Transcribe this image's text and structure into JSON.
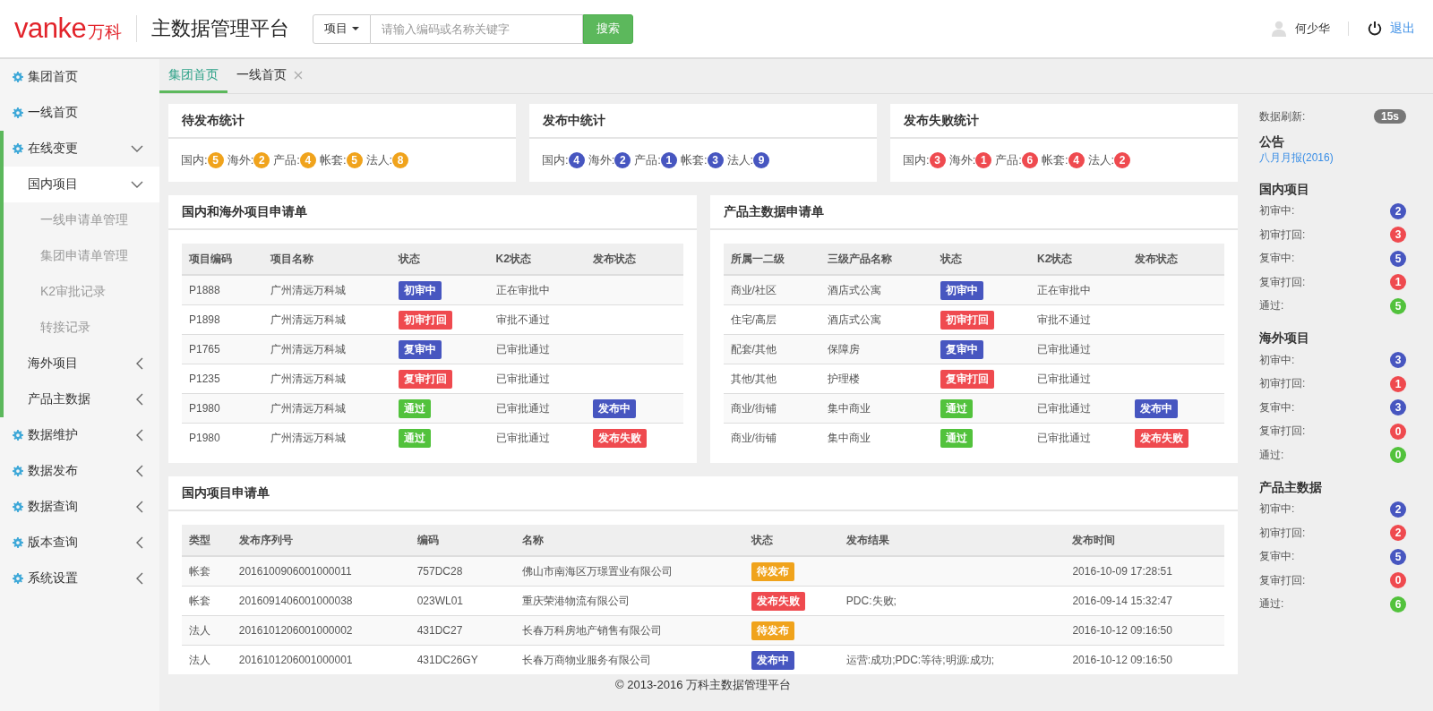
{
  "header": {
    "logo_text": "vanke",
    "logo_cn": "万科",
    "title": "主数据管理平台",
    "search": {
      "scope": "项目",
      "placeholder": "请输入编码或名称关键字",
      "button": "搜索"
    },
    "user": "何少华",
    "logout": "退出"
  },
  "sidebar": {
    "items": [
      {
        "label": "集团首页"
      },
      {
        "label": "一线首页"
      },
      {
        "label": "在线变更",
        "expanded": true,
        "children": [
          {
            "label": "国内项目",
            "expanded": true,
            "children": [
              {
                "label": "一线申请单管理"
              },
              {
                "label": "集团申请单管理"
              },
              {
                "label": "K2审批记录"
              },
              {
                "label": "转接记录"
              }
            ]
          },
          {
            "label": "海外项目",
            "expanded": false
          },
          {
            "label": "产品主数据",
            "expanded": false
          }
        ]
      },
      {
        "label": "数据维护",
        "expanded": false
      },
      {
        "label": "数据发布",
        "expanded": false
      },
      {
        "label": "数据查询",
        "expanded": false
      },
      {
        "label": "版本查询",
        "expanded": false
      },
      {
        "label": "系统设置",
        "expanded": false
      }
    ]
  },
  "tabs": [
    {
      "label": "集团首页",
      "selected": true,
      "closable": false
    },
    {
      "label": "一线首页",
      "selected": false,
      "closable": true
    }
  ],
  "stat_cards": [
    {
      "title": "待发布统计",
      "color": "#f0a31c",
      "items": [
        {
          "label": "国内:",
          "count": "5"
        },
        {
          "label": "海外:",
          "count": "2"
        },
        {
          "label": "产品:",
          "count": "4"
        },
        {
          "label": "帐套:",
          "count": "5"
        },
        {
          "label": "法人:",
          "count": "8"
        }
      ]
    },
    {
      "title": "发布中统计",
      "color": "#4756c0",
      "items": [
        {
          "label": "国内:",
          "count": "4"
        },
        {
          "label": "海外:",
          "count": "2"
        },
        {
          "label": "产品:",
          "count": "1"
        },
        {
          "label": "帐套:",
          "count": "3"
        },
        {
          "label": "法人:",
          "count": "9"
        }
      ]
    },
    {
      "title": "发布失败统计",
      "color": "#ef4a4f",
      "items": [
        {
          "label": "国内:",
          "count": "3"
        },
        {
          "label": "海外:",
          "count": "1"
        },
        {
          "label": "产品:",
          "count": "6"
        },
        {
          "label": "帐套:",
          "count": "4"
        },
        {
          "label": "法人:",
          "count": "2"
        }
      ]
    }
  ],
  "project_table": {
    "title": "国内和海外项目申请单",
    "columns": [
      "项目编码",
      "项目名称",
      "状态",
      "K2状态",
      "发布状态"
    ],
    "rows": [
      {
        "cells": [
          "P1888",
          "广州清远万科城"
        ],
        "status": {
          "text": "初审中",
          "color": "#4756c0"
        },
        "k2": "正在审批中"
      },
      {
        "cells": [
          "P1898",
          "广州清远万科城"
        ],
        "status": {
          "text": "初审打回",
          "color": "#ef4a4f"
        },
        "k2": "审批不通过"
      },
      {
        "cells": [
          "P1765",
          "广州清远万科城"
        ],
        "status": {
          "text": "复审中",
          "color": "#4756c0"
        },
        "k2": "已审批通过"
      },
      {
        "cells": [
          "P1235",
          "广州清远万科城"
        ],
        "status": {
          "text": "复审打回",
          "color": "#ef4a4f"
        },
        "k2": "已审批通过"
      },
      {
        "cells": [
          "P1980",
          "广州清远万科城"
        ],
        "status": {
          "text": "通过",
          "color": "#52c23c"
        },
        "k2": "已审批通过",
        "publish": {
          "text": "发布中",
          "color": "#4756c0"
        }
      },
      {
        "cells": [
          "P1980",
          "广州清远万科城"
        ],
        "status": {
          "text": "通过",
          "color": "#52c23c"
        },
        "k2": "已审批通过",
        "publish": {
          "text": "发布失败",
          "color": "#ef4a4f"
        }
      }
    ]
  },
  "product_table": {
    "title": "产品主数据申请单",
    "columns": [
      "所属一二级",
      "三级产品名称",
      "状态",
      "K2状态",
      "发布状态"
    ],
    "rows": [
      {
        "cells": [
          "商业/社区",
          "酒店式公寓"
        ],
        "status": {
          "text": "初审中",
          "color": "#4756c0"
        },
        "k2": "正在审批中"
      },
      {
        "cells": [
          "住宅/高层",
          "酒店式公寓"
        ],
        "status": {
          "text": "初审打回",
          "color": "#ef4a4f"
        },
        "k2": "审批不通过"
      },
      {
        "cells": [
          "配套/其他",
          "保障房"
        ],
        "status": {
          "text": "复审中",
          "color": "#4756c0"
        },
        "k2": "已审批通过"
      },
      {
        "cells": [
          "其他/其他",
          "护理楼"
        ],
        "status": {
          "text": "复审打回",
          "color": "#ef4a4f"
        },
        "k2": "已审批通过"
      },
      {
        "cells": [
          "商业/街铺",
          "集中商业"
        ],
        "status": {
          "text": "通过",
          "color": "#52c23c"
        },
        "k2": "已审批通过",
        "publish": {
          "text": "发布中",
          "color": "#4756c0"
        }
      },
      {
        "cells": [
          "商业/街铺",
          "集中商业"
        ],
        "status": {
          "text": "通过",
          "color": "#52c23c"
        },
        "k2": "已审批通过",
        "publish": {
          "text": "发布失败",
          "color": "#ef4a4f"
        }
      }
    ]
  },
  "domestic_table": {
    "title": "国内项目申请单",
    "columns": [
      "类型",
      "发布序列号",
      "编码",
      "名称",
      "状态",
      "发布结果",
      "发布时间"
    ],
    "rows": [
      {
        "type": "帐套",
        "serial": "2016100906001000011",
        "code": "757DC28",
        "name": "佛山市南海区万璟置业有限公司",
        "status": {
          "text": "待发布",
          "color": "#f0a31c"
        },
        "result": "",
        "time": "2016-10-09 17:28:51"
      },
      {
        "type": "帐套",
        "serial": "2016091406001000038",
        "code": "023WL01",
        "name": "重庆荣港物流有限公司",
        "status": {
          "text": "发布失败",
          "color": "#ef4a4f"
        },
        "result": "PDC:失败;",
        "time": "2016-09-14 15:32:47"
      },
      {
        "type": "法人",
        "serial": "2016101206001000002",
        "code": "431DC27",
        "name": "长春万科房地产销售有限公司",
        "status": {
          "text": "待发布",
          "color": "#f0a31c"
        },
        "result": "",
        "time": "2016-10-12 09:16:50"
      },
      {
        "type": "法人",
        "serial": "2016101206001000001",
        "code": "431DC26GY",
        "name": "长春万商物业服务有限公司",
        "status": {
          "text": "发布中",
          "color": "#4756c0"
        },
        "result": "运营:成功;PDC:等待;明源:成功;",
        "time": "2016-10-12 09:16:50"
      }
    ]
  },
  "right_panel": {
    "refresh_label": "数据刷新:",
    "refresh_value": "15s",
    "notice_title": "公告",
    "notice_link": "八月月报(2016)",
    "groups": [
      {
        "title": "国内项目",
        "items": [
          {
            "label": "初审中:",
            "count": "2",
            "color": "#4756c0"
          },
          {
            "label": "初审打回:",
            "count": "3",
            "color": "#ef4a4f"
          },
          {
            "label": "复审中:",
            "count": "5",
            "color": "#4756c0"
          },
          {
            "label": "复审打回:",
            "count": "1",
            "color": "#ef4a4f"
          },
          {
            "label": "通过:",
            "count": "5",
            "color": "#52c23c"
          }
        ]
      },
      {
        "title": "海外项目",
        "items": [
          {
            "label": "初审中:",
            "count": "3",
            "color": "#4756c0"
          },
          {
            "label": "初审打回:",
            "count": "1",
            "color": "#ef4a4f"
          },
          {
            "label": "复审中:",
            "count": "3",
            "color": "#4756c0"
          },
          {
            "label": "复审打回:",
            "count": "0",
            "color": "#ef4a4f"
          },
          {
            "label": "通过:",
            "count": "0",
            "color": "#52c23c"
          }
        ]
      },
      {
        "title": "产品主数据",
        "items": [
          {
            "label": "初审中:",
            "count": "2",
            "color": "#4756c0"
          },
          {
            "label": "初审打回:",
            "count": "2",
            "color": "#ef4a4f"
          },
          {
            "label": "复审中:",
            "count": "5",
            "color": "#4756c0"
          },
          {
            "label": "复审打回:",
            "count": "0",
            "color": "#ef4a4f"
          },
          {
            "label": "通过:",
            "count": "6",
            "color": "#52c23c"
          }
        ]
      }
    ]
  },
  "footer": "© 2013-2016 万科主数据管理平台"
}
